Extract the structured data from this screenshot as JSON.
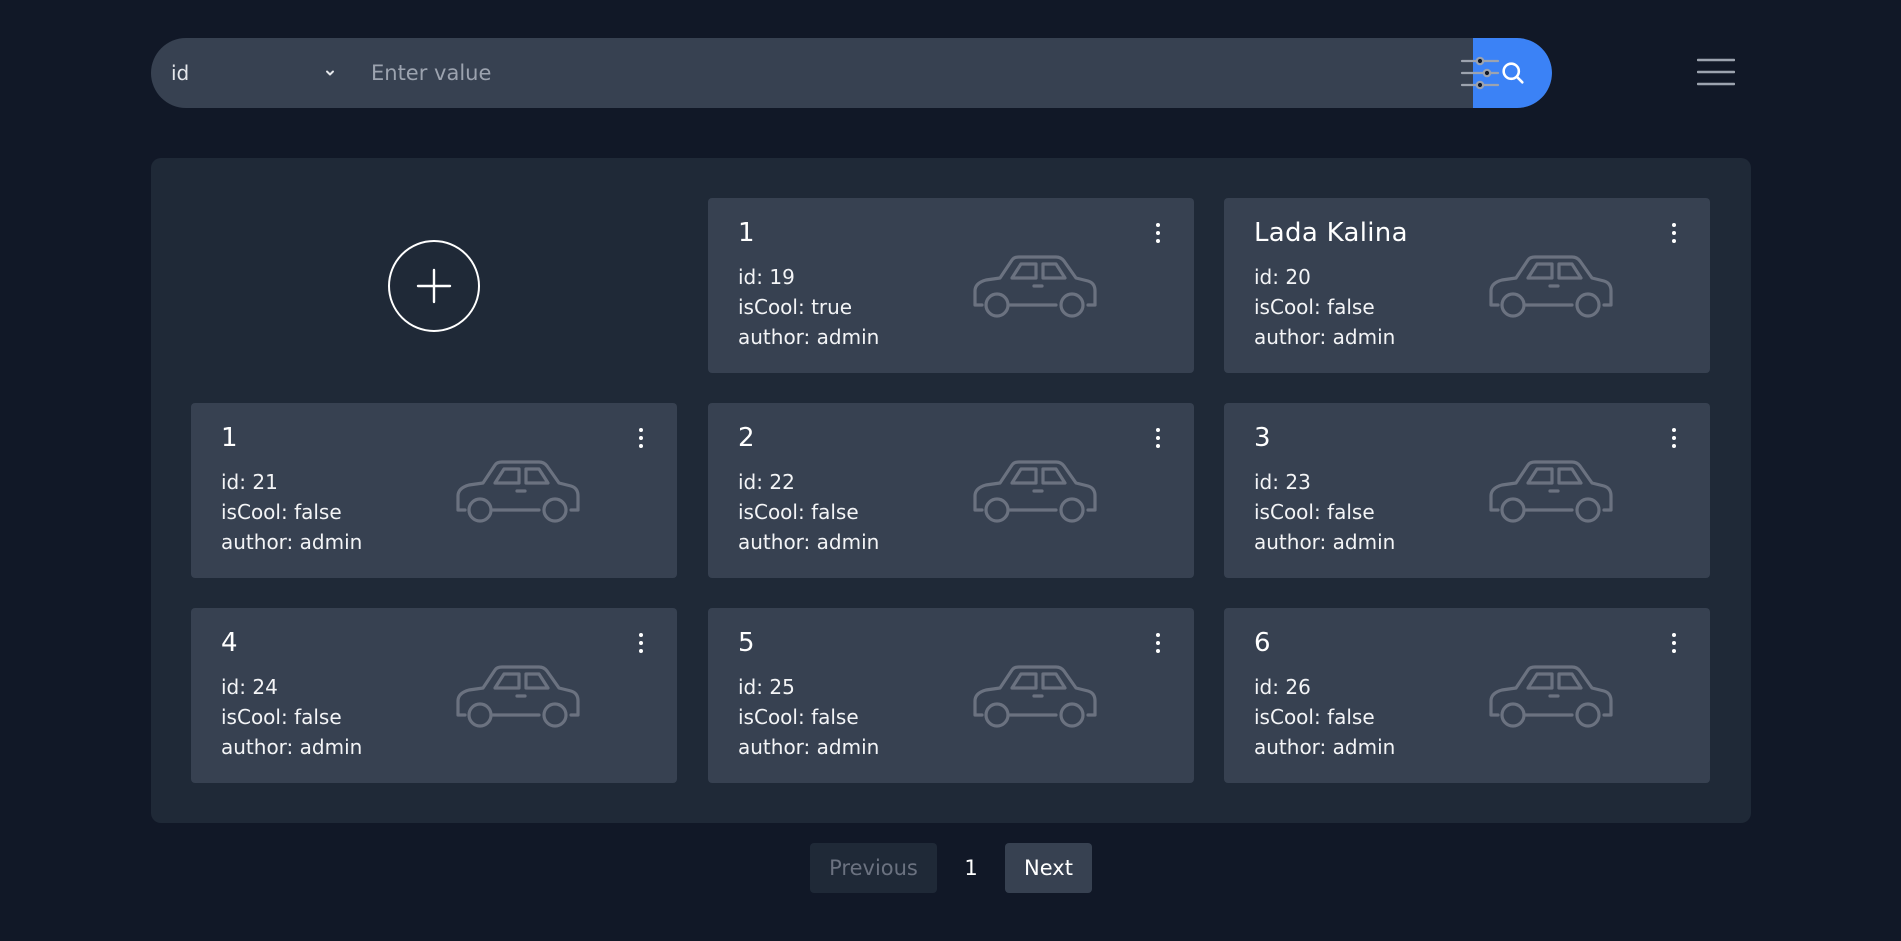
{
  "search": {
    "field_value": "id",
    "placeholder": "Enter value",
    "search_icon": "search-icon",
    "chevron_icon": "chevron-down-icon"
  },
  "toolbar": {
    "filter_icon": "sliders-icon",
    "menu_icon": "hamburger-menu-icon"
  },
  "add_card": {
    "icon": "plus-circle-icon"
  },
  "cards": [
    {
      "title": "1",
      "id_text": "id: 19",
      "cool_text": "isCool: true",
      "author_text": "author: admin"
    },
    {
      "title": "Lada Kalina",
      "id_text": "id: 20",
      "cool_text": "isCool: false",
      "author_text": "author: admin"
    },
    {
      "title": "1",
      "id_text": "id: 21",
      "cool_text": "isCool: false",
      "author_text": "author: admin"
    },
    {
      "title": "2",
      "id_text": "id: 22",
      "cool_text": "isCool: false",
      "author_text": "author: admin"
    },
    {
      "title": "3",
      "id_text": "id: 23",
      "cool_text": "isCool: false",
      "author_text": "author: admin"
    },
    {
      "title": "4",
      "id_text": "id: 24",
      "cool_text": "isCool: false",
      "author_text": "author: admin"
    },
    {
      "title": "5",
      "id_text": "id: 25",
      "cool_text": "isCool: false",
      "author_text": "author: admin"
    },
    {
      "title": "6",
      "id_text": "id: 26",
      "cool_text": "isCool: false",
      "author_text": "author: admin"
    }
  ],
  "card_icons": {
    "car": "car-icon",
    "more": "more-vertical-icon"
  },
  "pagination": {
    "prev_label": "Previous",
    "current_page": "1",
    "next_label": "Next"
  },
  "colors": {
    "background": "#111827",
    "panel": "#1f2937",
    "card": "#374151",
    "accent": "#3b82f6"
  }
}
